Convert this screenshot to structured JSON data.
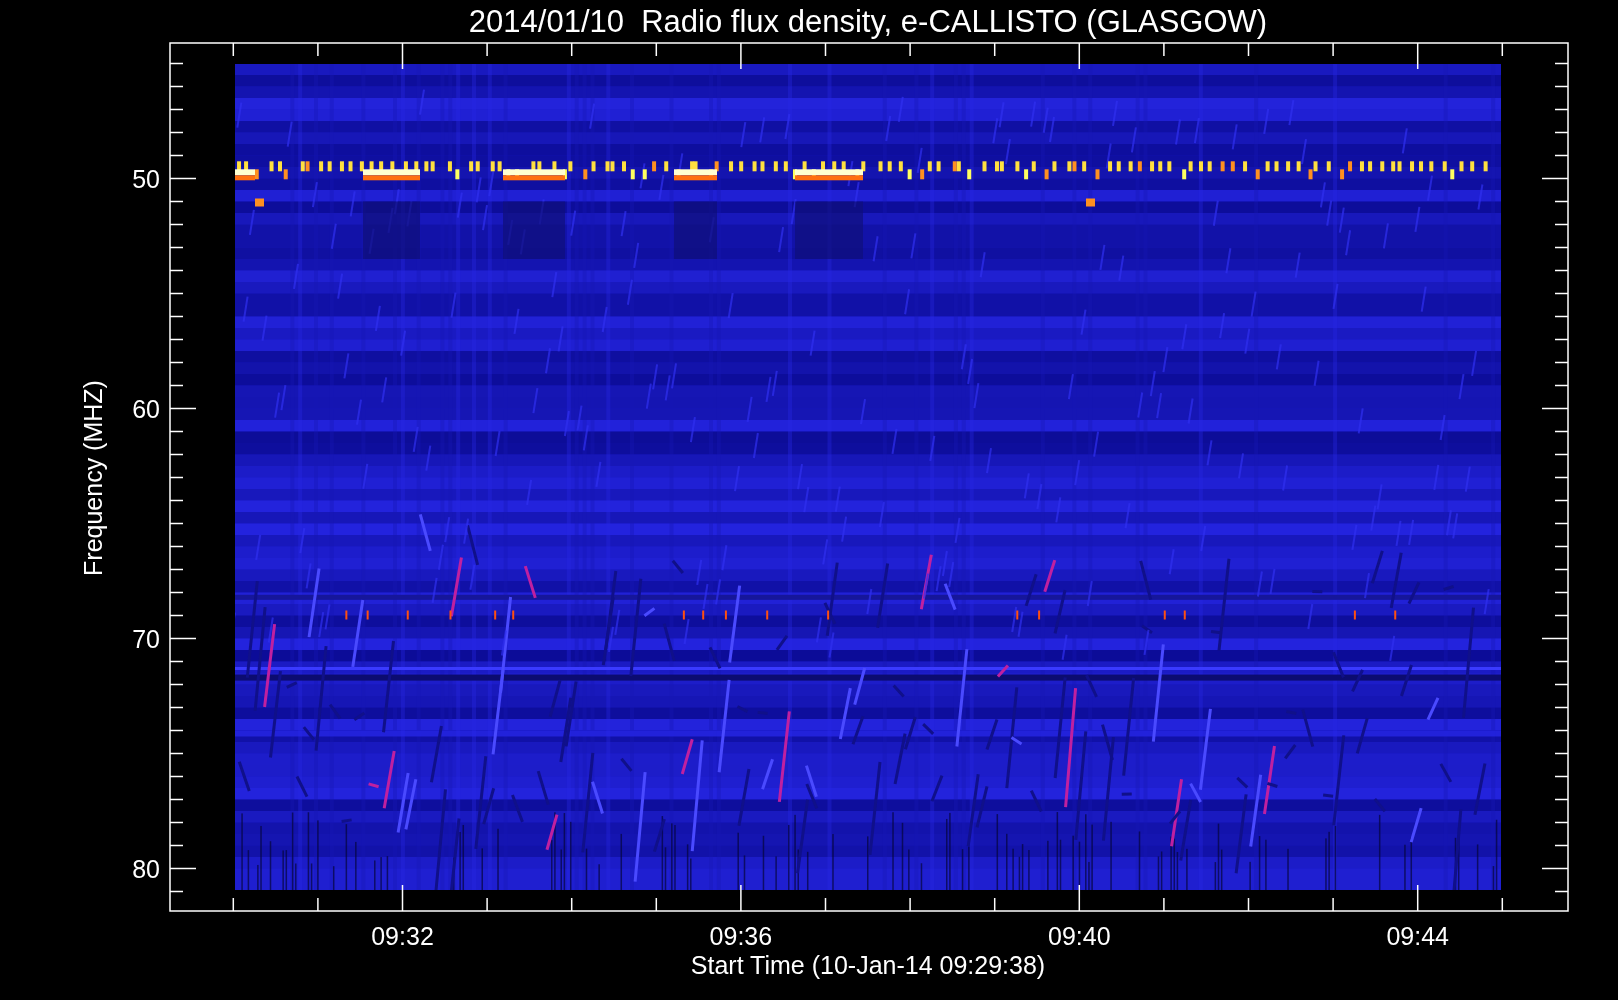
{
  "title": "2014/01/10  Radio flux density, e-CALLISTO (GLASGOW)",
  "y_axis": {
    "label": "Frequency (MHZ)",
    "ticks": [
      "50",
      "60",
      "70",
      "80"
    ]
  },
  "x_axis": {
    "label": "Start Time (10-Jan-14 09:29:38)",
    "ticks": [
      "09:32",
      "09:36",
      "09:40",
      "09:44"
    ]
  }
}
